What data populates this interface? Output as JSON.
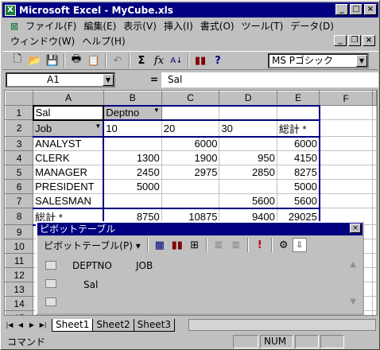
{
  "window": {
    "title": "Microsoft Excel - MyCube.xls"
  },
  "menu": {
    "items": [
      "ファイル(F)",
      "編集(E)",
      "表示(V)",
      "挿入(I)",
      "書式(O)",
      "ツール(T)",
      "データ(D)",
      "ウィンドウ(W)",
      "ヘルプ(H)"
    ]
  },
  "toolbar": {
    "font": "MS Pゴシック",
    "sum_icon": "Σ",
    "fx_icon": "fx"
  },
  "formula": {
    "cell": "A1",
    "equals": "=",
    "value": "Sal"
  },
  "columns": [
    "A",
    "B",
    "C",
    "D",
    "E",
    "F"
  ],
  "rows": [
    [
      "Sal",
      "Deptno",
      "",
      "",
      "",
      ""
    ],
    [
      "Job",
      "10",
      "20",
      "30",
      "総計 *",
      ""
    ],
    [
      "ANALYST",
      "",
      "6000",
      "",
      "6000",
      ""
    ],
    [
      "CLERK",
      "1300",
      "1900",
      "950",
      "4150",
      ""
    ],
    [
      "MANAGER",
      "2450",
      "2975",
      "2850",
      "8275",
      ""
    ],
    [
      "PRESIDENT",
      "5000",
      "",
      "",
      "5000",
      ""
    ],
    [
      "SALESMAN",
      "",
      "",
      "5600",
      "5600",
      ""
    ],
    [
      "総計 *",
      "8750",
      "10875",
      "9400",
      "29025",
      ""
    ],
    [
      "",
      "",
      "",
      "",
      "",
      ""
    ],
    [
      "",
      "",
      "",
      "",
      "",
      ""
    ],
    [
      "",
      "",
      "",
      "",
      "",
      ""
    ],
    [
      "",
      "",
      "",
      "",
      "",
      ""
    ],
    [
      "",
      "",
      "",
      "",
      "",
      ""
    ],
    [
      "",
      "",
      "",
      "",
      "",
      ""
    ],
    [
      "",
      "",
      "",
      "",
      "",
      ""
    ]
  ],
  "pivot": {
    "title": "ピボットテーブル",
    "menu": "ピボットテーブル(P)",
    "fields": {
      "deptno": "DEPTNO",
      "job": "JOB",
      "sal": "Sal"
    }
  },
  "sheets": [
    "Sheet1",
    "Sheet2",
    "Sheet3"
  ],
  "status": {
    "mode": "コマンド",
    "num": "NUM"
  }
}
